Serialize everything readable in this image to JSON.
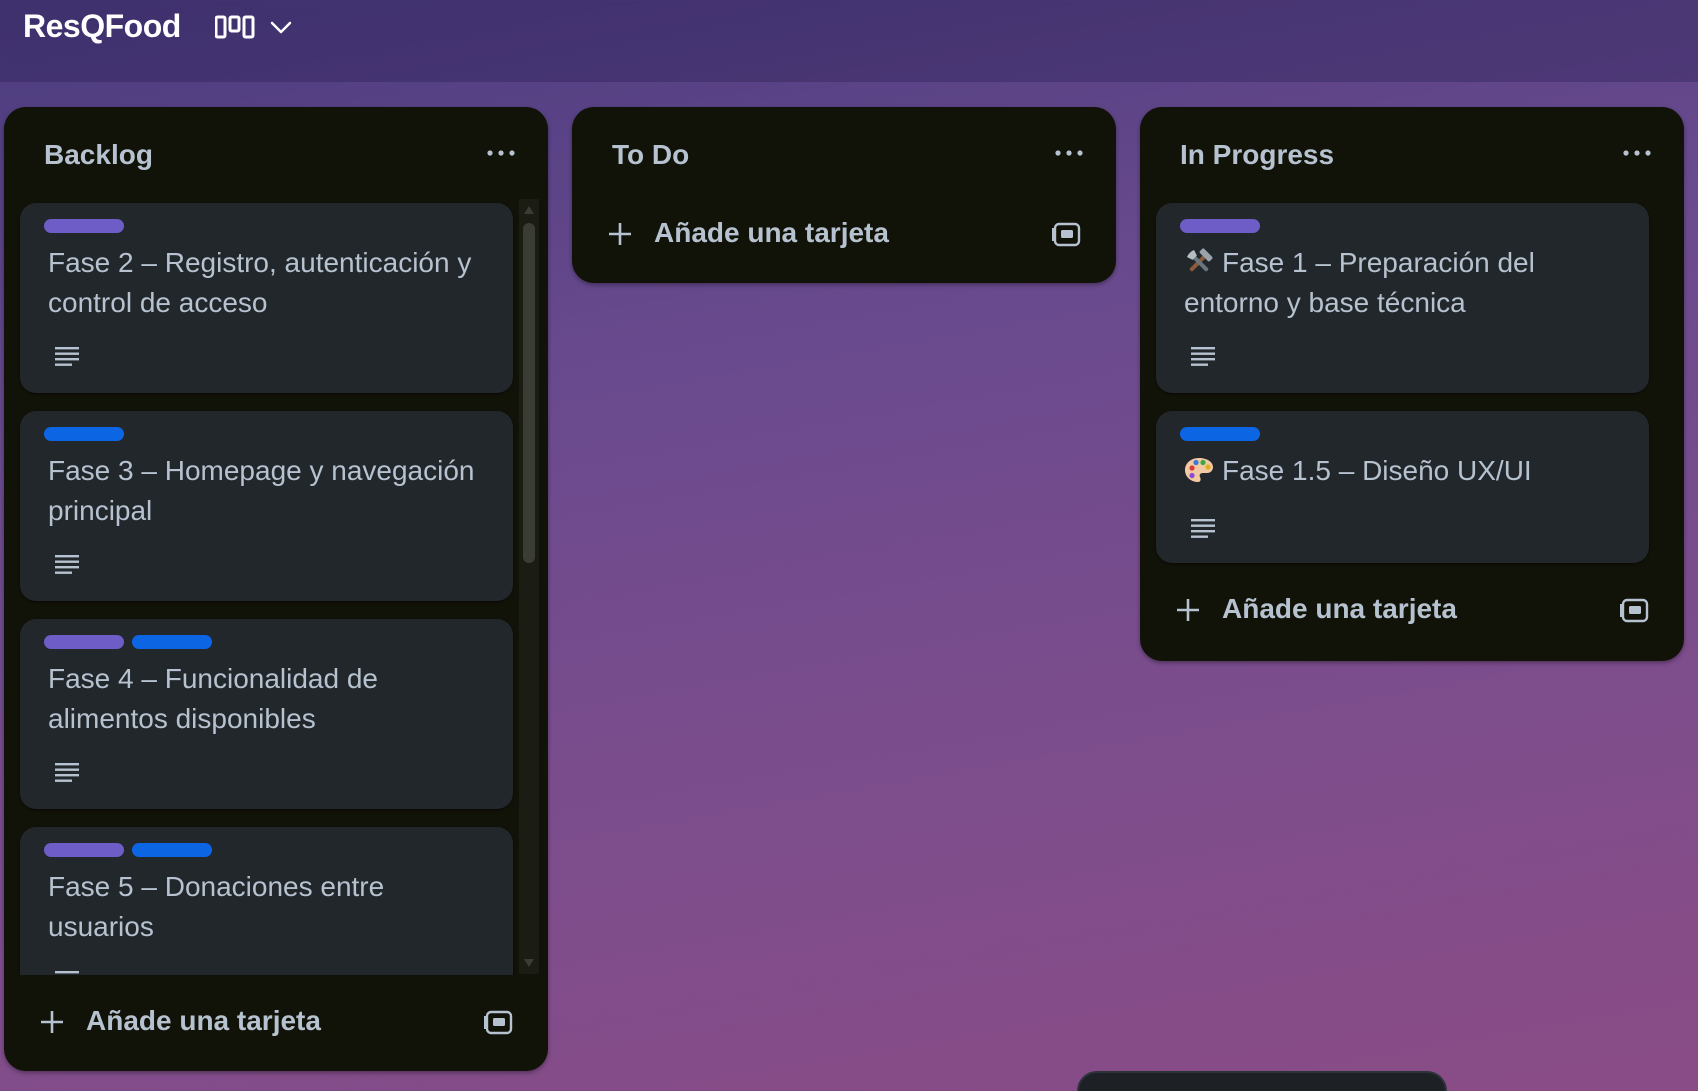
{
  "board": {
    "title": "ResQFood"
  },
  "icons": {
    "view": "board-view-icon",
    "chevron": "chevron-down-icon",
    "menu": "more-horizontal-icon",
    "description": "description-lines-icon",
    "add": "plus-icon",
    "template": "card-template-icon"
  },
  "colors": {
    "label_purple": "#6e5dc6",
    "label_blue": "#0c66e4",
    "list_bg": "#111208",
    "card_bg": "#22272b",
    "text": "#b6c2cf"
  },
  "lists": [
    {
      "title": "Backlog",
      "add_label": "Añade una tarjeta",
      "cards": [
        {
          "title": "Fase 2 – Registro, autenticación y control de acceso",
          "labels": [
            "purple"
          ]
        },
        {
          "title": "Fase 3 – Homepage y navegación principal",
          "labels": [
            "blue"
          ]
        },
        {
          "title": "Fase 4 – Funcionalidad de alimentos disponibles",
          "labels": [
            "purple",
            "blue"
          ]
        },
        {
          "title": "Fase 5 – Donaciones entre usuarios",
          "labels": [
            "purple",
            "blue"
          ]
        }
      ]
    },
    {
      "title": "To Do",
      "add_label": "Añade una tarjeta",
      "cards": []
    },
    {
      "title": "In Progress",
      "add_label": "Añade una tarjeta",
      "cards": [
        {
          "emoji": "tools-icon",
          "title": "Fase 1 – Preparación del entorno y base técnica",
          "labels": [
            "purple"
          ]
        },
        {
          "emoji": "palette-icon",
          "title": "Fase 1.5 – Diseño UX/UI",
          "labels": [
            "blue"
          ]
        }
      ]
    }
  ]
}
